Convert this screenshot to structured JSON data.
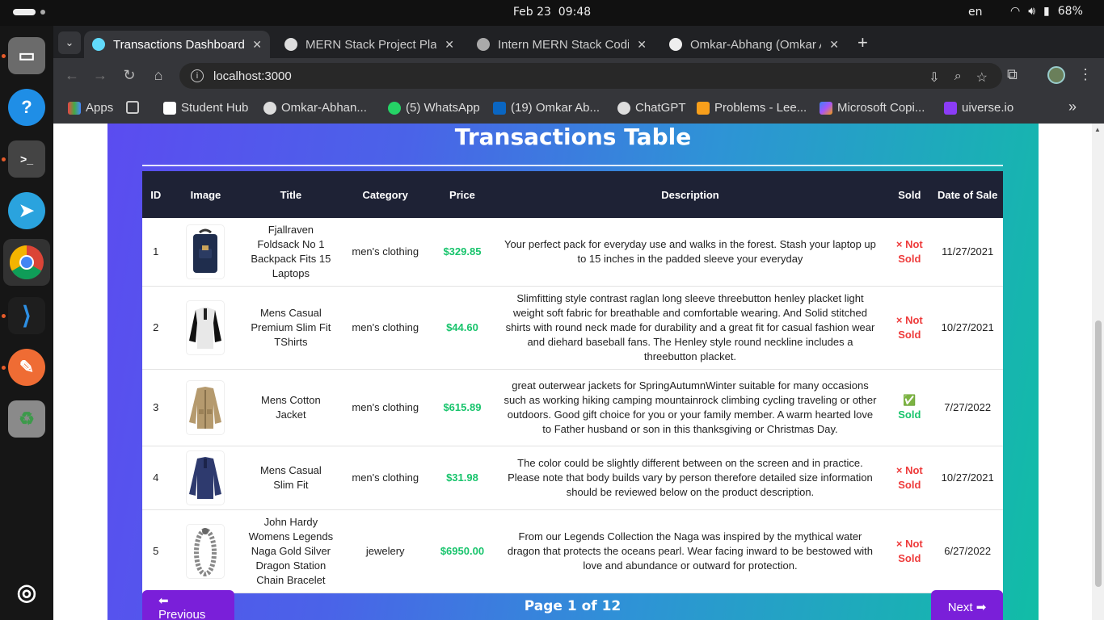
{
  "system": {
    "date": "Feb 23",
    "time": "09:48",
    "lang": "en",
    "battery": "68%"
  },
  "tabs": [
    {
      "title": "Transactions Dashboard",
      "active": true
    },
    {
      "title": "MERN Stack Project Plan"
    },
    {
      "title": "Intern MERN Stack Codin"
    },
    {
      "title": "Omkar-Abhang (Omkar A"
    }
  ],
  "address": {
    "url": "localhost:3000"
  },
  "bookmarks": [
    "Apps",
    "Student Hub",
    "Omkar-Abhan...",
    "(5) WhatsApp",
    "(19) Omkar Ab...",
    "ChatGPT",
    "Problems - Lee...",
    "Microsoft Copi...",
    "uiverse.io"
  ],
  "page": {
    "title": "Transactions Table",
    "columns": [
      "ID",
      "Image",
      "Title",
      "Category",
      "Price",
      "Description",
      "Sold",
      "Date of Sale"
    ],
    "rows": [
      {
        "id": "1",
        "image": "backpack",
        "title": "Fjallraven Foldsack No 1 Backpack Fits 15 Laptops",
        "category": "men's clothing",
        "price": "$329.85",
        "description": "Your perfect pack for everyday use and walks in the forest. Stash your laptop up to 15 inches in the padded sleeve your everyday",
        "sold": "× Not Sold",
        "sold_flag": false,
        "date": "11/27/2021"
      },
      {
        "id": "2",
        "image": "raglan-shirt",
        "title": "Mens Casual Premium Slim Fit TShirts",
        "category": "men's clothing",
        "price": "$44.60",
        "description": "Slimfitting style contrast raglan long sleeve threebutton henley placket light weight soft fabric for breathable and comfortable wearing. And Solid stitched shirts with round neck made for durability and a great fit for casual fashion wear and diehard baseball fans. The Henley style round neckline includes a threebutton placket.",
        "sold": "× Not Sold",
        "sold_flag": false,
        "date": "10/27/2021"
      },
      {
        "id": "3",
        "image": "cotton-jacket",
        "title": "Mens Cotton Jacket",
        "category": "men's clothing",
        "price": "$615.89",
        "description": "great outerwear jackets for SpringAutumnWinter suitable for many occasions such as working hiking camping mountainrock climbing cycling traveling or other outdoors. Good gift choice for you or your family member. A warm hearted love to Father husband or son in this thanksgiving or Christmas Day.",
        "sold": "✅ Sold",
        "sold_flag": true,
        "date": "7/27/2022"
      },
      {
        "id": "4",
        "image": "slim-fit-shirt",
        "title": "Mens Casual Slim Fit",
        "category": "men's clothing",
        "price": "$31.98",
        "description": "The color could be slightly different between on the screen and in practice. Please note that body builds vary by person therefore detailed size information should be reviewed below on the product description.",
        "sold": "× Not Sold",
        "sold_flag": false,
        "date": "10/27/2021"
      },
      {
        "id": "5",
        "image": "dragon-bracelet",
        "title": "John Hardy Womens Legends Naga Gold Silver Dragon Station Chain Bracelet",
        "category": "jewelery",
        "price": "$6950.00",
        "description": "From our Legends Collection the Naga was inspired by the mythical water dragon that protects the oceans pearl. Wear facing inward to be bestowed with love and abundance or outward for protection.",
        "sold": "× Not Sold",
        "sold_flag": false,
        "date": "6/27/2022"
      }
    ],
    "pagination": {
      "prev": "⬅ Previous",
      "info": "Page 1 of 12",
      "next": "Next ➡"
    }
  },
  "colors": {
    "accent_purple": "#7a1fd9",
    "header_dark": "#1e2235",
    "price_green": "#18c46c",
    "not_sold_red": "#ee3b3b"
  }
}
